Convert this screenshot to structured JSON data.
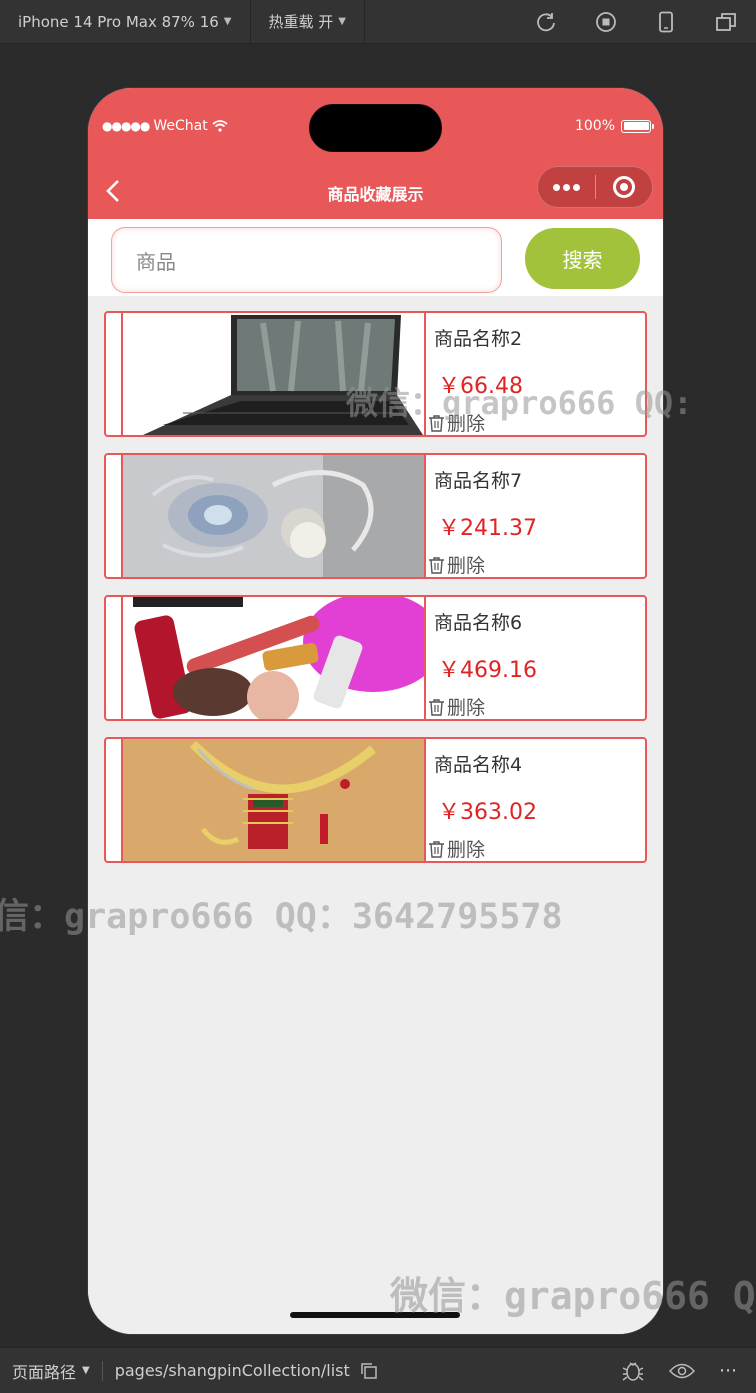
{
  "toolbar": {
    "device": "iPhone 14 Pro Max 87% 16",
    "hot_reload": "热重载 开"
  },
  "status_bar": {
    "carrier": "WeChat",
    "battery": "100%"
  },
  "nav": {
    "title": "商品收藏展示"
  },
  "search": {
    "value": "商品",
    "button": "搜索"
  },
  "items": [
    {
      "name": "商品名称2",
      "price": "￥66.48",
      "delete": "删除",
      "image": "laptop"
    },
    {
      "name": "商品名称7",
      "price": "￥241.37",
      "delete": "删除",
      "image": "jewelry-brooch"
    },
    {
      "name": "商品名称6",
      "price": "￥469.16",
      "delete": "删除",
      "image": "cosmetics"
    },
    {
      "name": "商品名称4",
      "price": "￥363.02",
      "delete": "删除",
      "image": "necklace"
    }
  ],
  "watermarks": [
    "微信：grapro666 QQ:",
    "信：grapro666 QQ：3642795578",
    "微信：grapro666 QQ"
  ],
  "bottom_bar": {
    "label": "页面路径",
    "path": "pages/shangpinCollection/list"
  },
  "colors": {
    "accent": "#e95858",
    "search_button": "#a3c23b",
    "price": "#e02424"
  }
}
